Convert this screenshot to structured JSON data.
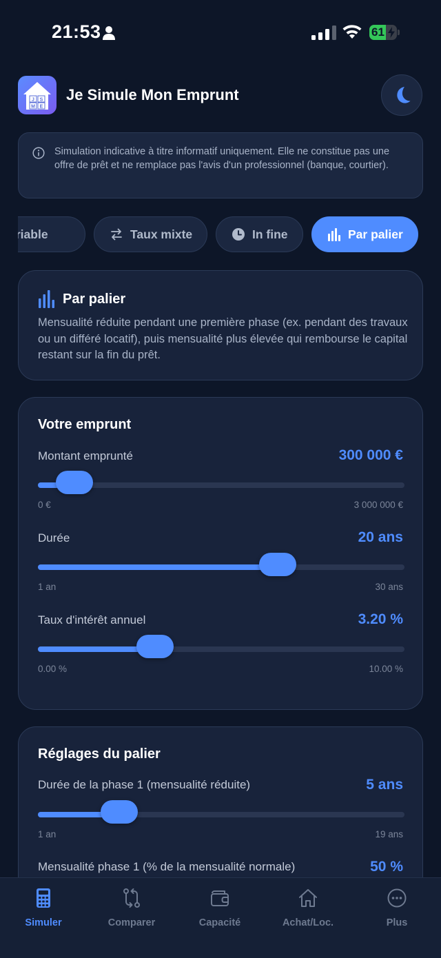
{
  "status_bar": {
    "time": "21:53",
    "battery": "61",
    "battery_level": 0.61
  },
  "header": {
    "title": "Je Simule Mon Emprunt",
    "logo_letters": [
      "J",
      "S",
      "M",
      "E"
    ]
  },
  "disclaimer": {
    "text": "Simulation indicative à titre informatif uniquement. Elle ne constitue pas une offre de prêt et ne remplace pas l'avis d'un professionnel (banque, courtier)."
  },
  "tabs": [
    {
      "label": "Taux variable",
      "icon": "trend-icon"
    },
    {
      "label": "Taux mixte",
      "icon": "swap-icon"
    },
    {
      "label": "In fine",
      "icon": "clock-icon"
    },
    {
      "label": "Par palier",
      "icon": "bar-chart-icon",
      "active": true
    }
  ],
  "mode_card": {
    "title": "Par palier",
    "description": "Mensualité réduite pendant une première phase (ex. pendant des travaux ou un différé locatif), puis mensualité plus élevée qui rembourse le capital restant sur la fin du prêt."
  },
  "loan_card": {
    "title": "Votre emprunt",
    "amount": {
      "label": "Montant emprunté",
      "value": "300 000 €",
      "min": "0 €",
      "max": "3 000 000 €",
      "level": 0.1
    },
    "duration": {
      "label": "Durée",
      "value": "20 ans",
      "min": "1 an",
      "max": "30 ans",
      "level": 0.655
    },
    "rate": {
      "label": "Taux d'intérêt annuel",
      "value": "3.20 %",
      "min": "0.00 %",
      "max": "10.00 %",
      "level": 0.32
    }
  },
  "tier_card": {
    "title": "Réglages du palier",
    "phase1_duration": {
      "label": "Durée de la phase 1 (mensualité réduite)",
      "value": "5 ans",
      "min": "1 an",
      "max": "19 ans",
      "level": 0.222
    },
    "phase1_payment": {
      "label": "Mensualité phase 1 (% de la mensualité normale)",
      "value": "50 %"
    }
  },
  "bottom_nav": [
    {
      "label": "Simuler",
      "icon": "calculator-icon",
      "active": true
    },
    {
      "label": "Comparer",
      "icon": "compare-icon"
    },
    {
      "label": "Capacité",
      "icon": "wallet-icon"
    },
    {
      "label": "Achat/Loc.",
      "icon": "home-icon"
    },
    {
      "label": "Plus",
      "icon": "more-icon"
    }
  ],
  "colors": {
    "accent": "#4f8cff",
    "background": "#0d1628",
    "card": "#18233b",
    "border": "#2b3a57"
  }
}
